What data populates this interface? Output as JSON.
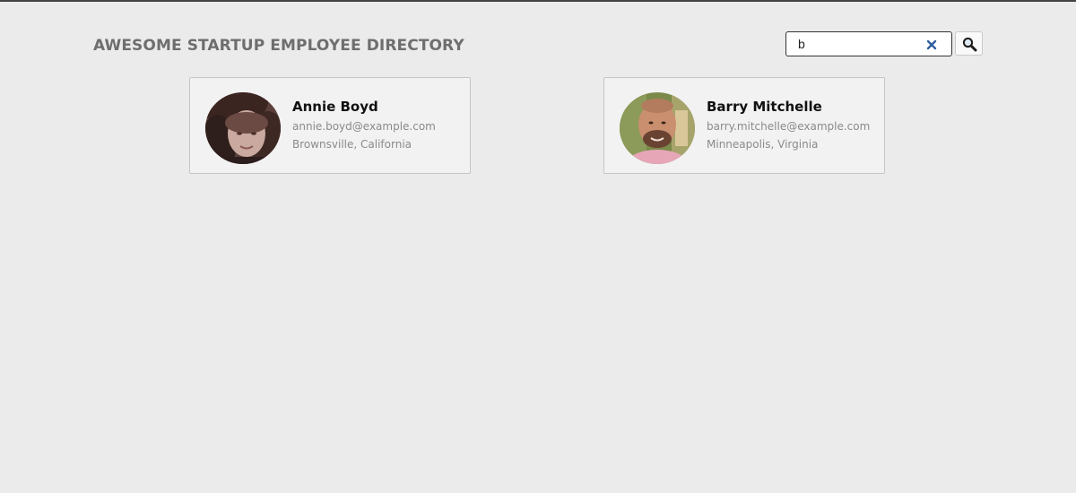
{
  "header": {
    "title": "AWESOME STARTUP EMPLOYEE DIRECTORY"
  },
  "search": {
    "value": "b",
    "clear_icon": "close-icon",
    "search_icon": "magnifier-icon"
  },
  "employees": [
    {
      "name": "Annie Boyd",
      "email": "annie.boyd@example.com",
      "location": "Brownsville, California",
      "avatar": "profile-photo"
    },
    {
      "name": "Barry Mitchelle",
      "email": "barry.mitchelle@example.com",
      "location": "Minneapolis, Virginia",
      "avatar": "profile-photo"
    }
  ],
  "colors": {
    "background": "#ebebeb",
    "card_background": "#f2f2f2",
    "title_text": "#6e6e6e",
    "clear_icon": "#2f5f9e"
  }
}
